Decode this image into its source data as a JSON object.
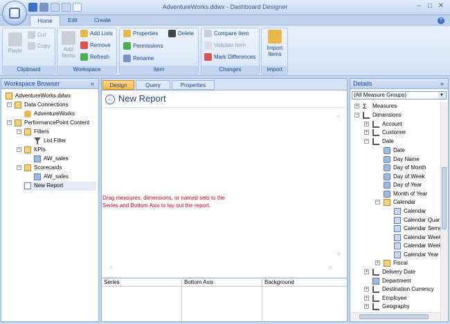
{
  "window": {
    "title": "AdventureWorks.ddwx - Dashboard Designer",
    "controls": [
      "–",
      "□",
      "✕"
    ]
  },
  "tabs": [
    "Home",
    "Edit",
    "Create"
  ],
  "ribbon": {
    "clipboard": {
      "label": "Clipboard",
      "paste": "Paste",
      "cut": "Cut",
      "copy": "Copy"
    },
    "workspace": {
      "label": "Workspace",
      "add_items_1": "Add",
      "add_items_2": "Items",
      "add_lists": "Add Lists",
      "remove": "Remove",
      "refresh": "Refresh"
    },
    "item": {
      "label": "Item",
      "properties": "Properties",
      "delete": "Delete",
      "permissions": "Permissions",
      "rename": "Rename"
    },
    "changes": {
      "label": "Changes",
      "compare_item": "Compare Item",
      "validate_item": "Validate Item",
      "mark_differences": "Mark Differences"
    },
    "import": {
      "label": "Import",
      "import_items_1": "Import",
      "import_items_2": "Items"
    }
  },
  "workspace_browser": {
    "title": "Workspace Browser",
    "collapse": "«",
    "tree": [
      {
        "label": "AdventureWorks.ddwx",
        "level": 0
      },
      {
        "label": "Data Connections",
        "level": 1
      },
      {
        "label": "AdventureWorks",
        "level": 2
      },
      {
        "label": "PerformancePoint Content",
        "level": 1
      },
      {
        "label": "Filters",
        "level": 2
      },
      {
        "label": "List Filter",
        "level": 3
      },
      {
        "label": "KPIs",
        "level": 2
      },
      {
        "label": "AW_sales",
        "level": 3
      },
      {
        "label": "Scorecards",
        "level": 2
      },
      {
        "label": "AW_sales",
        "level": 3
      },
      {
        "label": "New Report",
        "level": 2
      }
    ]
  },
  "center": {
    "tabs": [
      "Design",
      "Query",
      "Properties"
    ],
    "report_title": "New Report",
    "hint": "Drag measures, dimensions, or named sets to the Series and Bottom Axis to lay out the report.",
    "columns": [
      "Series",
      "Bottom Axis",
      "Background"
    ]
  },
  "details": {
    "title": "Details",
    "expand": "»",
    "select_value": "(All Measure Groups)",
    "tree": [
      {
        "label": "Measures",
        "level": 0
      },
      {
        "label": "Dimensions",
        "level": 0
      },
      {
        "label": "Account",
        "level": 1
      },
      {
        "label": "Customer",
        "level": 1
      },
      {
        "label": "Date",
        "level": 1
      },
      {
        "label": "Date",
        "level": 2
      },
      {
        "label": "Day Name",
        "level": 2
      },
      {
        "label": "Day of Month",
        "level": 2
      },
      {
        "label": "Day of Week",
        "level": 2
      },
      {
        "label": "Day of Year",
        "level": 2
      },
      {
        "label": "Month of Year",
        "level": 2
      },
      {
        "label": "Calendar",
        "level": 2
      },
      {
        "label": "Calendar",
        "level": 3
      },
      {
        "label": "Calendar Quarter",
        "level": 3
      },
      {
        "label": "Calendar Semester",
        "level": 3
      },
      {
        "label": "Calendar Week",
        "level": 3
      },
      {
        "label": "Calendar Week",
        "level": 3
      },
      {
        "label": "Calendar Year",
        "level": 3
      },
      {
        "label": "Fiscal",
        "level": 2
      },
      {
        "label": "Delivery Date",
        "level": 1
      },
      {
        "label": "Department",
        "level": 1
      },
      {
        "label": "Destination Currency",
        "level": 1
      },
      {
        "label": "Employee",
        "level": 1
      },
      {
        "label": "Geography",
        "level": 1
      }
    ]
  }
}
